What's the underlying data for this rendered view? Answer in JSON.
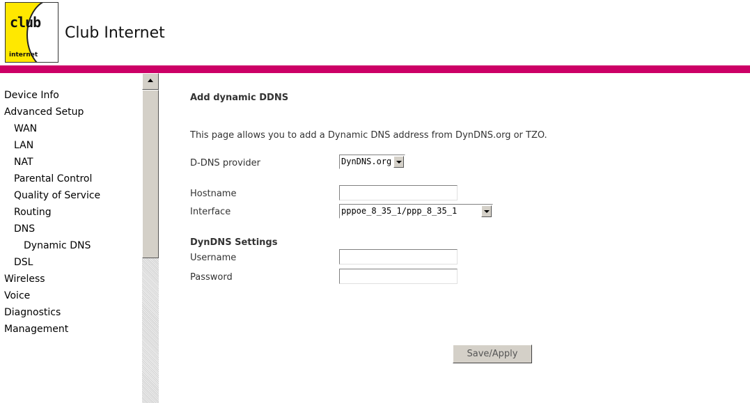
{
  "header": {
    "logo_text": "club",
    "logo_sub": "internet",
    "brand_name": "Club Internet"
  },
  "colors": {
    "accent_bar": "#cc0066",
    "logo_yellow": "#ffe800"
  },
  "sidebar": {
    "items": [
      {
        "label": "Device Info"
      },
      {
        "label": "Advanced Setup"
      },
      {
        "label": "WAN"
      },
      {
        "label": "LAN"
      },
      {
        "label": "NAT"
      },
      {
        "label": "Parental Control"
      },
      {
        "label": "Quality of Service"
      },
      {
        "label": "Routing"
      },
      {
        "label": "DNS"
      },
      {
        "label": "Dynamic DNS"
      },
      {
        "label": "DSL"
      },
      {
        "label": "Wireless"
      },
      {
        "label": "Voice"
      },
      {
        "label": "Diagnostics"
      },
      {
        "label": "Management"
      }
    ]
  },
  "main": {
    "title": "Add dynamic DDNS",
    "description": "This page allows you to add a Dynamic DNS address from DynDNS.org or TZO.",
    "provider_label": "D-DNS provider",
    "provider_value": "DynDNS.org",
    "hostname_label": "Hostname",
    "hostname_value": "",
    "interface_label": "Interface",
    "interface_value": "pppoe_8_35_1/ppp_8_35_1",
    "settings_heading": "DynDNS Settings",
    "username_label": "Username",
    "username_value": "",
    "password_label": "Password",
    "password_value": "",
    "save_label": "Save/Apply"
  }
}
